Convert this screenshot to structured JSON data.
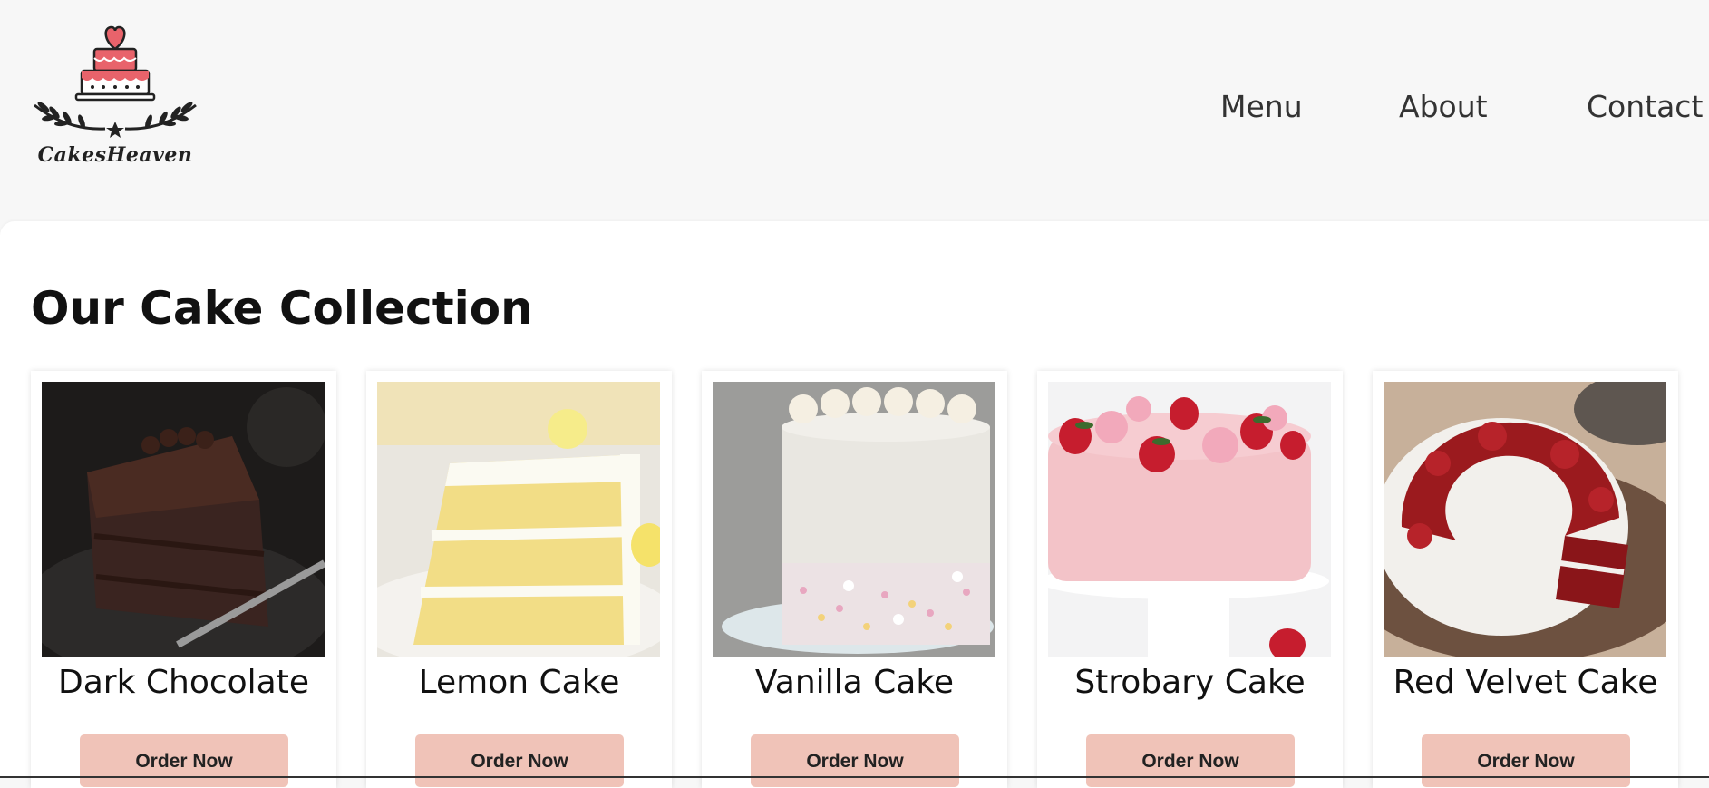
{
  "brand": {
    "name": "CakesHeaven"
  },
  "nav": {
    "items": [
      "Menu",
      "About",
      "Contact"
    ]
  },
  "section": {
    "title": "Our Cake Collection"
  },
  "cards": [
    {
      "name": "Dark Chocolate",
      "button": "Order Now"
    },
    {
      "name": "Lemon Cake",
      "button": "Order Now"
    },
    {
      "name": "Vanilla Cake",
      "button": "Order Now"
    },
    {
      "name": "Strobary Cake",
      "button": "Order Now"
    },
    {
      "name": "Red Velvet Cake",
      "button": "Order Now"
    }
  ],
  "colors": {
    "accent": "#f0c3b8",
    "logo_pink": "#e8636b",
    "background": "#f7f7f7"
  }
}
